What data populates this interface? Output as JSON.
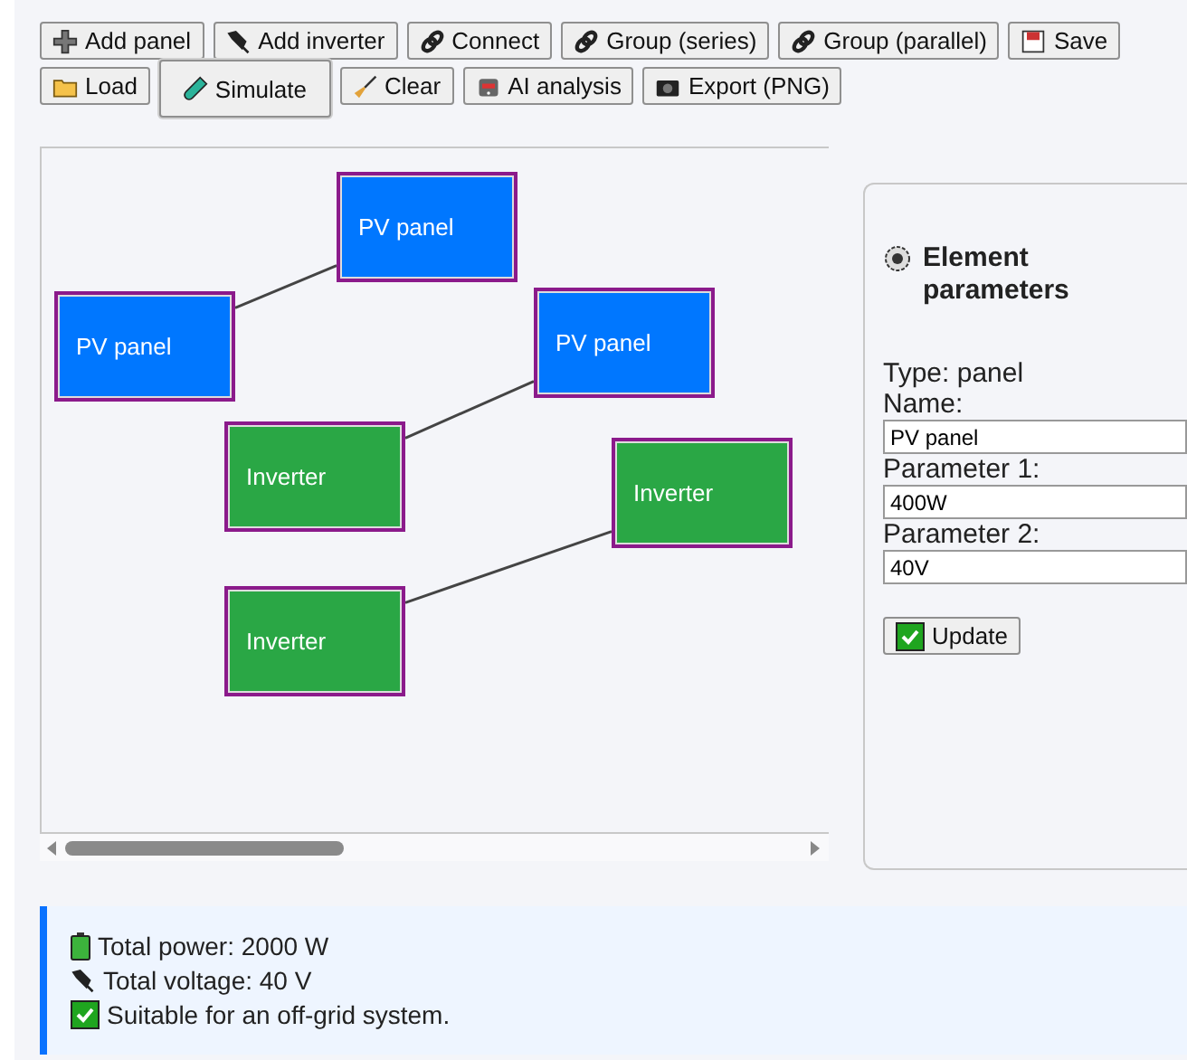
{
  "toolbar": [
    {
      "label": "Add panel",
      "selected": false
    },
    {
      "label": "Add inverter",
      "selected": false
    },
    {
      "label": "Connect",
      "selected": false
    },
    {
      "label": "Group (series)",
      "selected": false
    },
    {
      "label": "Group (parallel)",
      "selected": false
    },
    {
      "label": "Save",
      "selected": false
    },
    {
      "label": "Load",
      "selected": false
    },
    {
      "label": "Simulate",
      "selected": true
    },
    {
      "label": "Clear",
      "selected": false
    },
    {
      "label": "AI analysis",
      "selected": false
    },
    {
      "label": "Export (PNG)",
      "selected": false
    }
  ],
  "canvas": {
    "nodes": [
      {
        "label": "PV panel",
        "kind": "panel"
      },
      {
        "label": "PV panel",
        "kind": "panel"
      },
      {
        "label": "PV panel",
        "kind": "panel"
      },
      {
        "label": "Inverter",
        "kind": "inverter"
      },
      {
        "label": "Inverter",
        "kind": "inverter"
      },
      {
        "label": "Inverter",
        "kind": "inverter"
      }
    ]
  },
  "parameters": {
    "title": "Element parameters",
    "type_line": "Type: panel",
    "fields": [
      {
        "label": "Name:",
        "value": "PV panel"
      },
      {
        "label": "Parameter 1:",
        "value": "400W"
      },
      {
        "label": "Parameter 2:",
        "value": "40V"
      }
    ],
    "button": "Update"
  },
  "results": [
    "Total power: 2000 W",
    "Total voltage: 40 V",
    "Suitable for an off-grid system."
  ]
}
